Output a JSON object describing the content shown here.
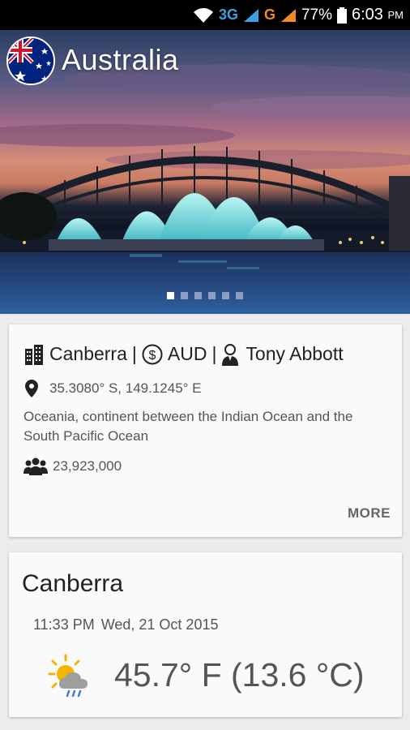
{
  "status_bar": {
    "network_3g": "3G",
    "network_g": "G",
    "battery": "77%",
    "time": "6:03",
    "ampm": "PM"
  },
  "hero": {
    "country": "Australia",
    "flag_icon": "australia-flag-icon",
    "slide_count": 6,
    "active_slide": 1
  },
  "info": {
    "capital": "Canberra",
    "currency": "AUD",
    "leader": "Tony Abbott",
    "separator": "|",
    "coordinates": "35.3080° S, 149.1245° E",
    "description": "Oceania, continent between the Indian Ocean and the South Pacific Ocean",
    "population": "23,923,000",
    "more_label": "MORE"
  },
  "weather": {
    "city": "Canberra",
    "time": "11:33 PM",
    "date": "Wed, 21 Oct 2015",
    "temperature": "45.7° F (13.6 °C)",
    "icon": "sun-cloud-rain-icon"
  },
  "colors": {
    "status_3g": "#3aa0e0",
    "status_g": "#f08a24",
    "card_bg": "#fafafa",
    "page_bg": "#ececec"
  }
}
